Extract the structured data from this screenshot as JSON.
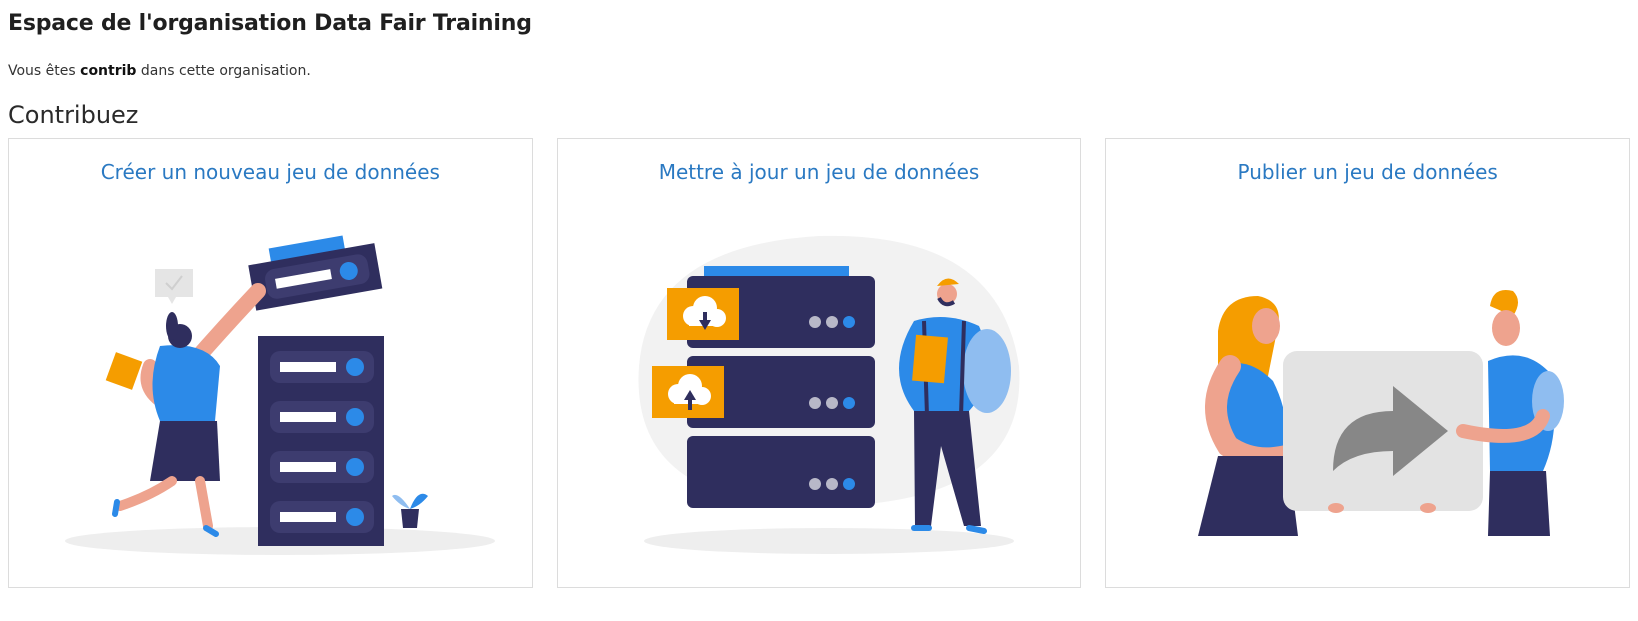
{
  "header": {
    "title": "Espace de l'organisation Data Fair Training",
    "role_prefix": "Vous êtes",
    "role": "contrib",
    "role_suffix": "dans cette organisation."
  },
  "section": {
    "title": "Contribuez"
  },
  "cards": [
    {
      "label": "Créer un nouveau jeu de données",
      "illustration": "create-dataset-illustration"
    },
    {
      "label": "Mettre à jour un jeu de données",
      "illustration": "update-dataset-illustration"
    },
    {
      "label": "Publier un jeu de données",
      "illustration": "publish-dataset-illustration"
    }
  ],
  "colors": {
    "link": "#2a79c2",
    "navy": "#2f2e5e",
    "blue": "#2c8ae8",
    "orange": "#f59d00",
    "skin": "#eea38e"
  }
}
